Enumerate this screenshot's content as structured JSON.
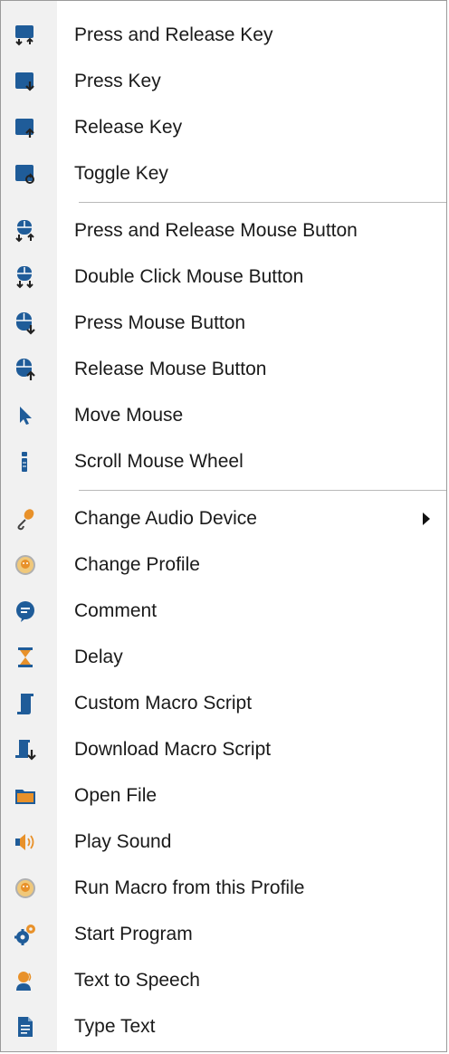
{
  "menu": {
    "group_keyboard": [
      {
        "label": "Press and Release Key",
        "icon": "key-press-release-icon"
      },
      {
        "label": "Press Key",
        "icon": "key-press-icon"
      },
      {
        "label": "Release Key",
        "icon": "key-release-icon"
      },
      {
        "label": "Toggle Key",
        "icon": "key-toggle-icon"
      }
    ],
    "group_mouse": [
      {
        "label": "Press and Release Mouse Button",
        "icon": "mouse-press-release-icon"
      },
      {
        "label": "Double Click Mouse Button",
        "icon": "mouse-double-click-icon"
      },
      {
        "label": "Press Mouse Button",
        "icon": "mouse-press-icon"
      },
      {
        "label": "Release Mouse Button",
        "icon": "mouse-release-icon"
      },
      {
        "label": "Move Mouse",
        "icon": "mouse-pointer-icon"
      },
      {
        "label": "Scroll Mouse Wheel",
        "icon": "scroll-wheel-icon"
      }
    ],
    "group_actions": [
      {
        "label": "Change Audio Device",
        "icon": "microphone-icon",
        "has_submenu": true
      },
      {
        "label": "Change Profile",
        "icon": "profile-icon"
      },
      {
        "label": "Comment",
        "icon": "comment-icon"
      },
      {
        "label": "Delay",
        "icon": "hourglass-icon"
      },
      {
        "label": "Custom Macro Script",
        "icon": "script-icon"
      },
      {
        "label": "Download Macro Script",
        "icon": "script-download-icon"
      },
      {
        "label": "Open File",
        "icon": "folder-icon"
      },
      {
        "label": "Play Sound",
        "icon": "speaker-icon"
      },
      {
        "label": "Run Macro from this Profile",
        "icon": "run-macro-icon"
      },
      {
        "label": "Start Program",
        "icon": "gears-icon"
      },
      {
        "label": "Text to Speech",
        "icon": "text-to-speech-icon"
      },
      {
        "label": "Type Text",
        "icon": "document-icon"
      }
    ]
  },
  "colors": {
    "icon_blue": "#1f5c99",
    "icon_orange": "#e8912a",
    "gutter": "#f1f1f1"
  }
}
